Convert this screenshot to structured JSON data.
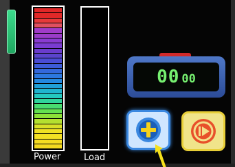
{
  "meters": {
    "power": {
      "label": "Power",
      "segments": [
        "#e02828",
        "#e02828",
        "#e63a3a",
        "#e05060",
        "#a03cc8",
        "#9a3cc8",
        "#8a3cd0",
        "#7a3cd0",
        "#6a3ccc",
        "#5a44cc",
        "#4a4cd4",
        "#3c5cd8",
        "#3468dc",
        "#2c78e0",
        "#2488e0",
        "#20a0d8",
        "#20b4d0",
        "#24c8c0",
        "#30d49c",
        "#48dc70",
        "#64e050",
        "#8ce038",
        "#b4e030",
        "#d8e028",
        "#f0e024",
        "#f4e024",
        "#f4dc22",
        "#f2d820"
      ]
    },
    "load": {
      "label": "Load",
      "segments": []
    }
  },
  "timer": {
    "minutes": "00",
    "seconds": "00"
  },
  "buttons": {
    "add": {
      "icon": "plus-icon"
    },
    "play": {
      "icon": "play-icon"
    }
  },
  "colors": {
    "timer_digits": "#76f070",
    "add_accent": "#3a88e0",
    "play_accent": "#e8cf38"
  }
}
